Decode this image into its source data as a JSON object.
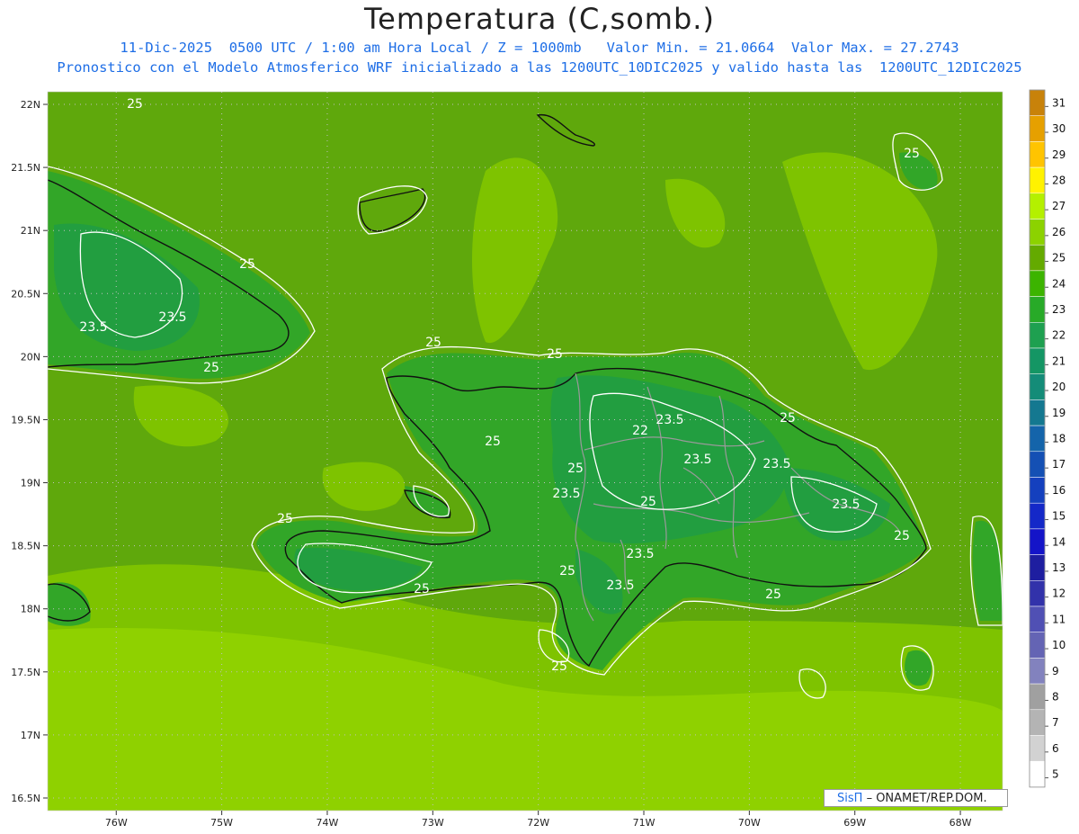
{
  "header": {
    "title": "Temperatura (C,somb.)",
    "line1": "11-Dic-2025  0500 UTC / 1:00 am Hora Local / Z = 1000mb   Valor Min. = 21.0664  Valor Max. = 27.2743",
    "line2": "Pronostico con el Modelo Atmosferico WRF inicializado a las 1200UTC_10DIC2025 y valido hasta las  1200UTC_12DIC2025"
  },
  "map": {
    "lon_range": [
      -76.65,
      -67.6
    ],
    "lat_range": [
      16.4,
      22.1
    ],
    "lat_ticks": [
      "22N",
      "21.5N",
      "21N",
      "20.5N",
      "20N",
      "19.5N",
      "19N",
      "18.5N",
      "18N",
      "17.5N",
      "17N",
      "16.5N"
    ],
    "lon_ticks": [
      "76W",
      "75W",
      "74W",
      "73W",
      "72W",
      "71W",
      "70W",
      "69W",
      "68W"
    ],
    "contour_labels": [
      "25",
      "25",
      "23.5",
      "23.5",
      "25",
      "25",
      "25",
      "25",
      "25",
      "23.5",
      "23.5",
      "22",
      "23.5",
      "25",
      "23.5",
      "23.5",
      "25",
      "23.5",
      "23.5",
      "25",
      "25",
      "25",
      "25",
      "25",
      "25",
      "25"
    ]
  },
  "colorbar": {
    "levels": [
      "31",
      "30",
      "29",
      "28",
      "27",
      "26",
      "25",
      "24",
      "23",
      "22",
      "21",
      "20",
      "19",
      "18",
      "17",
      "16",
      "15",
      "14",
      "13",
      "12",
      "11",
      "10",
      "9",
      "8",
      "7",
      "6",
      "5"
    ],
    "colors": [
      "#c8820a",
      "#e6a000",
      "#ffc400",
      "#fff200",
      "#b4f000",
      "#8cd200",
      "#64aa00",
      "#3cb400",
      "#28aa28",
      "#1ea050",
      "#149664",
      "#148c78",
      "#147890",
      "#1464aa",
      "#1450b4",
      "#1440be",
      "#1428c8",
      "#1414c8",
      "#1e1ea0",
      "#3232aa",
      "#5050b4",
      "#6464b4",
      "#8282be",
      "#a0a0a0",
      "#b4b4b4",
      "#d2d2d2",
      "#ffffff"
    ]
  },
  "fill_colors": {
    "sea_24": "#5fa80c",
    "zone_25": "#7ec300",
    "zone_26": "#8fd100",
    "land_23": "#32a628",
    "land_22": "#229e40",
    "coast": "#111111",
    "provinces": "#9a9a9a",
    "contour": "#ffffff"
  },
  "credit": {
    "sis": "SisΠ",
    "rest": "– ONAMET/REP.DOM."
  }
}
